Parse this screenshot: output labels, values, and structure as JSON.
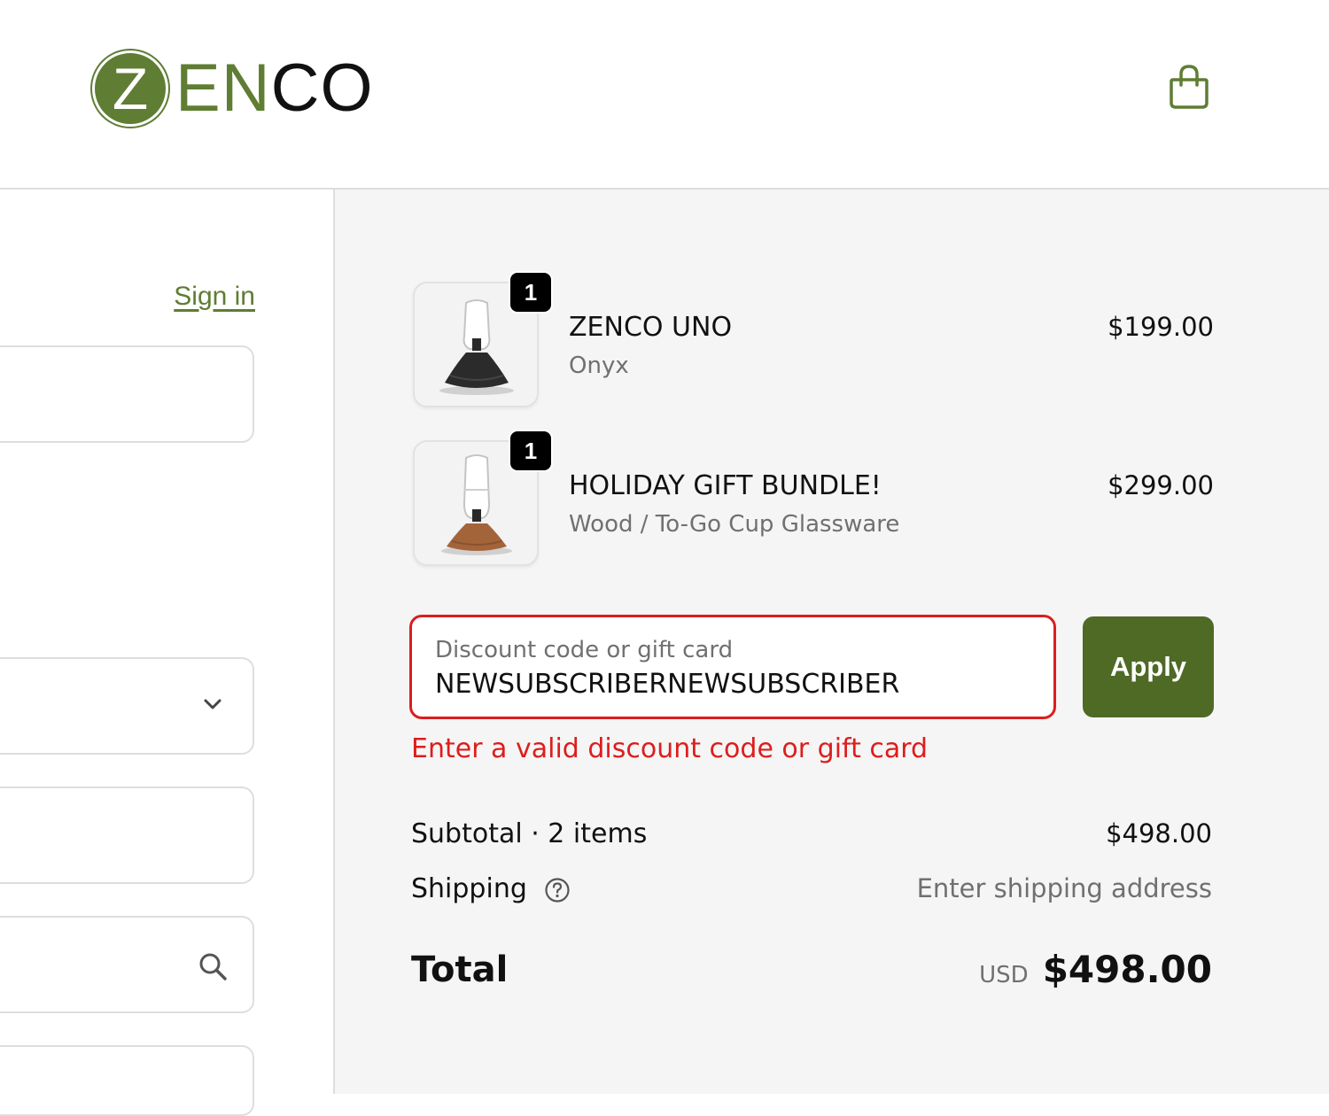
{
  "brand": {
    "logo_letter": "Z",
    "logo_text_green": "EN",
    "logo_text_dark": "CO",
    "accent_color": "#5f7d33",
    "button_color": "#4e6a25",
    "error_color": "#dd1d1d"
  },
  "header": {
    "cart_icon": "shopping-bag-icon"
  },
  "left": {
    "sign_in_label": "Sign in",
    "icons": {
      "select": "chevron-down-icon",
      "search": "search-icon"
    }
  },
  "cart": {
    "items": [
      {
        "quantity": "1",
        "name": "ZENCO UNO",
        "variant": "Onyx",
        "price": "$199.00"
      },
      {
        "quantity": "1",
        "name": "HOLIDAY GIFT BUNDLE!",
        "variant": "Wood / To-Go Cup Glassware",
        "price": "$299.00"
      }
    ]
  },
  "discount": {
    "label": "Discount code or gift card",
    "value": "NEWSUBSCRIBERNEWSUBSCRIBER",
    "apply_label": "Apply",
    "error": "Enter a valid discount code or gift card"
  },
  "summary": {
    "subtotal_label": "Subtotal · 2 items",
    "subtotal_value": "$498.00",
    "shipping_label": "Shipping",
    "shipping_value": "Enter shipping address",
    "total_label": "Total",
    "currency": "USD",
    "total_value": "$498.00"
  }
}
